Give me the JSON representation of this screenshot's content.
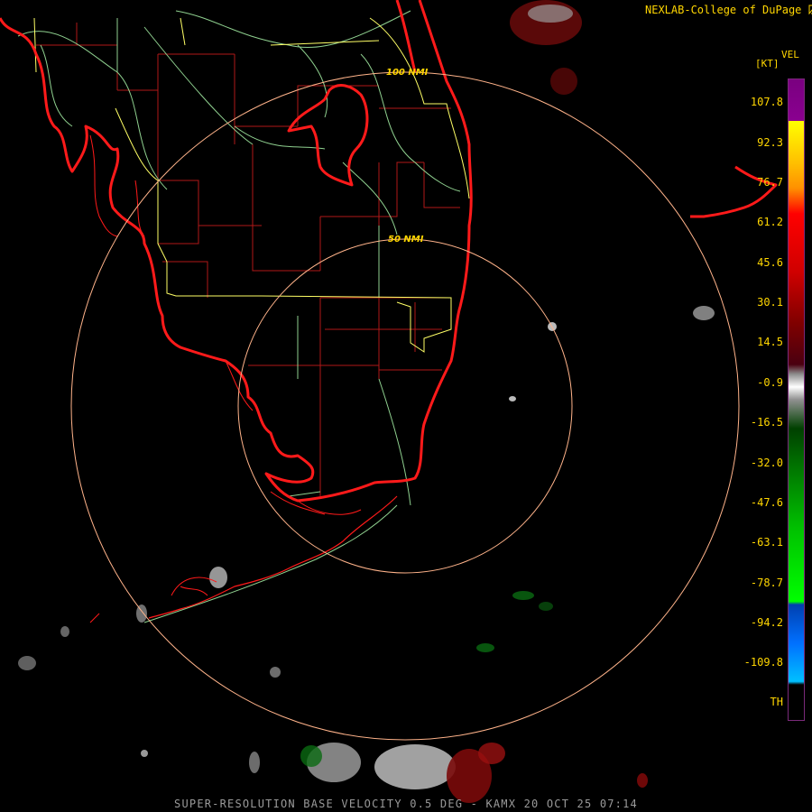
{
  "header": {
    "credit": "NEXLAB-College of DuPage"
  },
  "legend": {
    "title": "VEL",
    "units": "[KT]",
    "ticks": [
      "107.8",
      "92.3",
      "76.7",
      "61.2",
      "45.6",
      "30.1",
      "14.5",
      "-0.9",
      "-16.5",
      "-32.0",
      "-47.6",
      "-63.1",
      "-78.7",
      "-94.2",
      "-109.8",
      "TH"
    ]
  },
  "range_rings": {
    "inner_label": "50 NMI",
    "outer_label": "100 NMI"
  },
  "footer": {
    "product": "SUPER-RESOLUTION BASE VELOCITY 0.5 DEG - KAMX 20 OCT 25 07:14"
  },
  "icons": {
    "logo": "nexlab-mark-icon"
  },
  "colors": {
    "coast": "#ff1a1a",
    "county": "#b01818",
    "state": "#8fd08f",
    "warning": "#ffff66",
    "ring": "#ffb38a",
    "text": "#ffd600"
  }
}
